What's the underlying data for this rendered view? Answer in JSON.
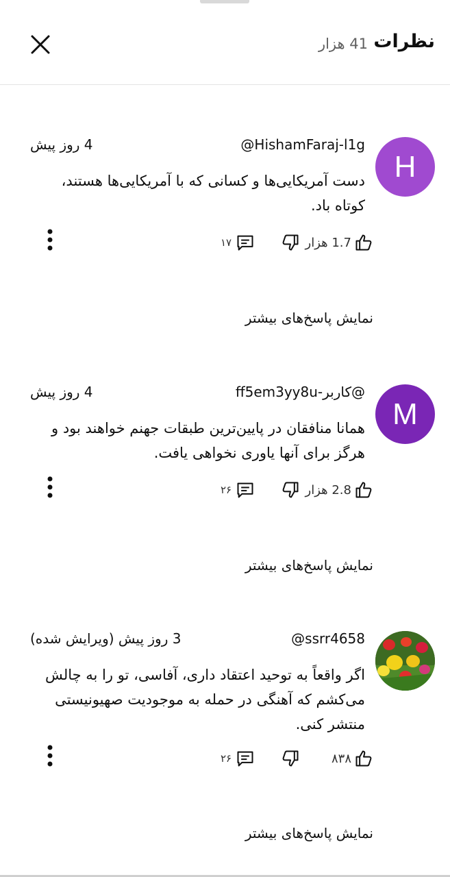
{
  "header": {
    "title": "نظرات",
    "count": "41 هزار",
    "close_icon": "close-icon"
  },
  "comments": [
    {
      "avatar_letter": "H",
      "avatar_color": "#a04ad0",
      "author": "@HishamFaraj-l1g",
      "time": "4 روز پیش",
      "text": "دست آمریکایی‌ها و کسانی که با آمریکایی‌ها هستند، کوتاه باد.",
      "likes": "1.7 هزار",
      "replies": "۱۷",
      "show_replies": "نمایش پاسخ‌های بیشتر"
    },
    {
      "avatar_letter": "M",
      "avatar_color": "#7a26b5",
      "author": "@کاربر-ff5em3yy8u",
      "time": "4 روز پیش",
      "text": "همانا منافقان در پایین‌ترین طبقات جهنم خواهند بود و هرگز برای آنها یاوری نخواهی یافت.",
      "likes": "2.8 هزار",
      "replies": "۲۶",
      "show_replies": "نمایش پاسخ‌های بیشتر"
    },
    {
      "avatar_letter": "",
      "avatar_image": "tulips-photo",
      "author": "@ssrr4658",
      "time": "3 روز پیش (ویرایش شده)",
      "text": "اگر واقعاً به توحید اعتقاد داری، آفاسی، تو را به چالش می‌کشم که آهنگی در حمله به موجودیت صهیونیستی منتشر کنی.",
      "likes": "۸۳۸",
      "replies": "۲۶",
      "show_replies": "نمایش پاسخ‌های بیشتر"
    }
  ],
  "icons": {
    "like": "thumb-up-icon",
    "dislike": "thumb-down-icon",
    "reply": "reply-icon",
    "more": "more-vert-icon"
  }
}
